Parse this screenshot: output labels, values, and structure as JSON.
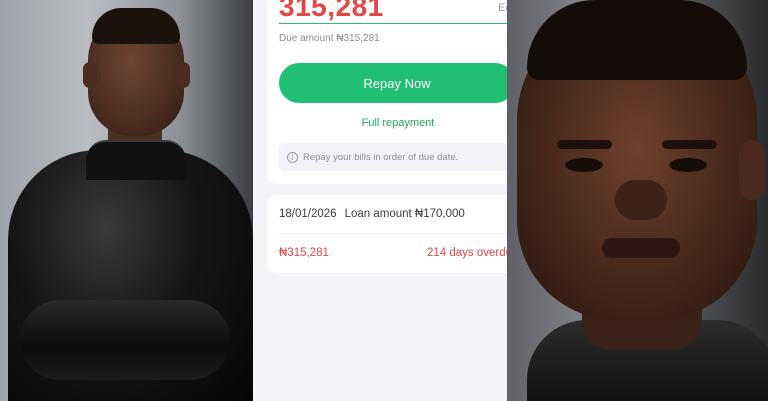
{
  "repayment": {
    "amount_display": "315,281",
    "side_label": "Ec",
    "due_amount_text": "Due amount ₦315,281",
    "repay_button_label": "Repay Now",
    "full_repayment_label": "Full repayment",
    "notice_text": "Repay your bills in order of due date.",
    "info_icon": "info-icon"
  },
  "loan": {
    "date": "18/01/2026",
    "loan_amount_text": "Loan amount ₦170,000",
    "amount_due": "₦315,281",
    "overdue_text": "214 days overdu"
  },
  "colors": {
    "accent_green": "#21bf73",
    "alert_red": "#e44545"
  }
}
